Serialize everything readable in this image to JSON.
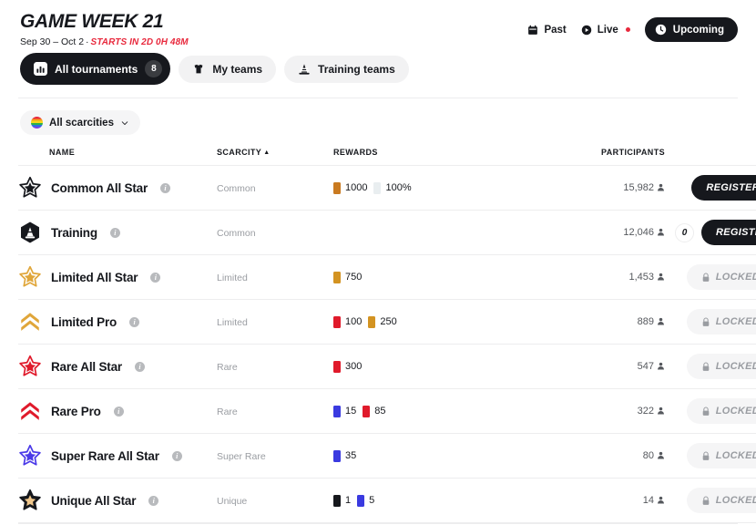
{
  "header": {
    "title": "GAME WEEK 21",
    "date_range": "Sep 30 – Oct 2",
    "separator": "·",
    "countdown": "STARTS IN 2D 0H 48M",
    "nav": [
      {
        "label": "Past",
        "icon": "calendar-icon",
        "active": false
      },
      {
        "label": "Live",
        "icon": "play-circle-icon",
        "active": false,
        "dot": true
      },
      {
        "label": "Upcoming",
        "icon": "clock-icon",
        "active": true
      }
    ]
  },
  "tabs": [
    {
      "label": "All tournaments",
      "icon": "bar-chart-icon",
      "badge": "8",
      "active": true
    },
    {
      "label": "My teams",
      "icon": "jersey-icon",
      "badge": null,
      "active": false
    },
    {
      "label": "Training teams",
      "icon": "traffic-cone-icon",
      "badge": null,
      "active": false
    }
  ],
  "filters": {
    "scarcity": {
      "label": "All scarcities",
      "icon": "rainbow-circle-icon",
      "chevron": "chevron-down-icon"
    }
  },
  "table": {
    "columns": [
      {
        "key": "name",
        "label": "NAME",
        "sorted": false
      },
      {
        "key": "scarcity",
        "label": "SCARCITY",
        "sorted": true,
        "sort_caret": "▲"
      },
      {
        "key": "rewards",
        "label": "REWARDS",
        "sorted": false
      },
      {
        "key": "participants",
        "label": "PARTICIPANTS",
        "sorted": false
      },
      {
        "key": "action",
        "label": "",
        "sorted": false
      }
    ],
    "rows": [
      {
        "name": "Common All Star",
        "icon": "star-outline-icon",
        "icon_color": "#16181d",
        "icon_fill": "none",
        "info": true,
        "scarcity": "Common",
        "rewards": [
          {
            "value": "1000",
            "color": "#c97a20"
          },
          {
            "value": "100%",
            "color": "#e9eef0"
          }
        ],
        "participants": "15,982",
        "action": {
          "type": "register",
          "label": "REGISTER"
        },
        "entries_badge": null
      },
      {
        "name": "Training",
        "icon": "hex-cone-icon",
        "icon_color": "#16181d",
        "icon_fill": "#16181d",
        "info": true,
        "scarcity": "Common",
        "rewards": [],
        "participants": "12,046",
        "action": {
          "type": "register",
          "label": "REGISTER"
        },
        "entries_badge": "0"
      },
      {
        "name": "Limited All Star",
        "icon": "star-outline-icon",
        "icon_color": "#e0a63a",
        "icon_fill": "none",
        "info": true,
        "scarcity": "Limited",
        "rewards": [
          {
            "value": "750",
            "color": "#d39321"
          }
        ],
        "participants": "1,453",
        "action": {
          "type": "locked",
          "label": "LOCKED",
          "icon": "lock-icon"
        },
        "entries_badge": null
      },
      {
        "name": "Limited Pro",
        "icon": "chevron-stripes-icon",
        "icon_color": "#e0a63a",
        "icon_fill": "#e0a63a",
        "info": true,
        "scarcity": "Limited",
        "rewards": [
          {
            "value": "100",
            "color": "#e01a2b"
          },
          {
            "value": "250",
            "color": "#d39321"
          }
        ],
        "participants": "889",
        "action": {
          "type": "locked",
          "label": "LOCKED",
          "icon": "lock-icon"
        },
        "entries_badge": null
      },
      {
        "name": "Rare All Star",
        "icon": "star-outline-icon",
        "icon_color": "#e01a2b",
        "icon_fill": "none",
        "info": true,
        "scarcity": "Rare",
        "rewards": [
          {
            "value": "300",
            "color": "#e01a2b"
          }
        ],
        "participants": "547",
        "action": {
          "type": "locked",
          "label": "LOCKED",
          "icon": "lock-icon"
        },
        "entries_badge": null
      },
      {
        "name": "Rare Pro",
        "icon": "chevron-stripes-icon",
        "icon_color": "#e01a2b",
        "icon_fill": "#e01a2b",
        "info": true,
        "scarcity": "Rare",
        "rewards": [
          {
            "value": "15",
            "color": "#3a3ae0"
          },
          {
            "value": "85",
            "color": "#e01a2b"
          }
        ],
        "participants": "322",
        "action": {
          "type": "locked",
          "label": "LOCKED",
          "icon": "lock-icon"
        },
        "entries_badge": null
      },
      {
        "name": "Super Rare All Star",
        "icon": "star-outline-icon",
        "icon_color": "#4b3ae8",
        "icon_fill": "none",
        "info": true,
        "scarcity": "Super Rare",
        "rewards": [
          {
            "value": "35",
            "color": "#3a3ae0"
          }
        ],
        "participants": "80",
        "action": {
          "type": "locked",
          "label": "LOCKED",
          "icon": "lock-icon"
        },
        "entries_badge": null
      },
      {
        "name": "Unique All Star",
        "icon": "star-outline-icon",
        "icon_color": "#16181d",
        "icon_fill": "#f0c78c",
        "info": true,
        "scarcity": "Unique",
        "rewards": [
          {
            "value": "1",
            "color": "#16181d"
          },
          {
            "value": "5",
            "color": "#3a3ae0"
          }
        ],
        "participants": "14",
        "action": {
          "type": "locked",
          "label": "LOCKED",
          "icon": "lock-icon"
        },
        "entries_badge": null
      }
    ]
  },
  "colors": {
    "accent_red": "#e8283c",
    "dark": "#16181d",
    "muted": "#9a9da2",
    "rule": "#ededee",
    "chip_bg": "#f5f5f6"
  }
}
